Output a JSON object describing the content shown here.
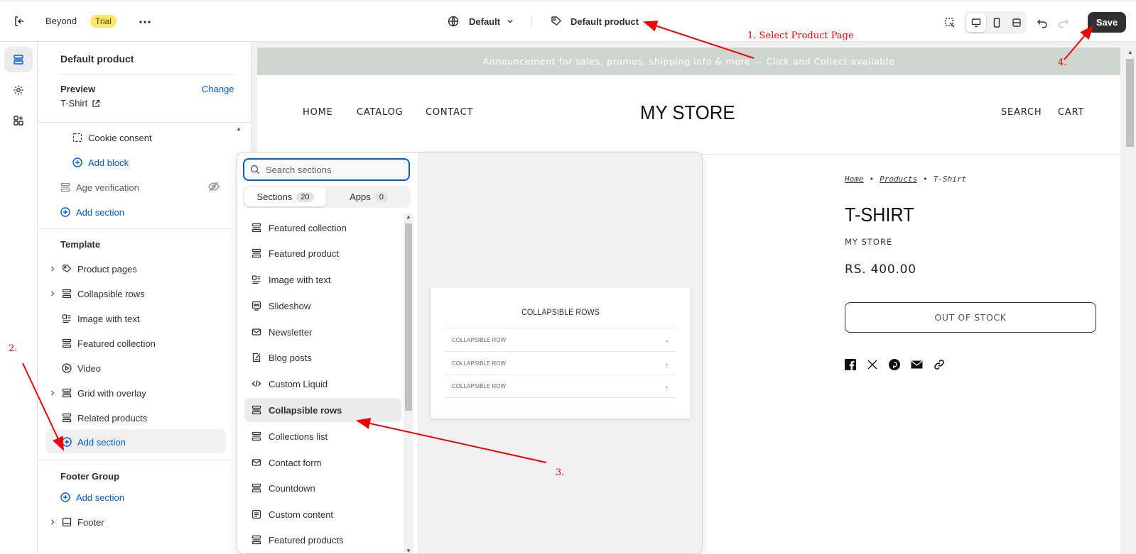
{
  "topbar": {
    "store_name": "Beyond",
    "trial_badge": "Trial",
    "theme_selector": "Default",
    "template_selector": "Default product",
    "save_label": "Save"
  },
  "panel": {
    "title": "Default product",
    "preview_label": "Preview",
    "change_link": "Change",
    "preview_item": "T-Shirt",
    "header_items": [
      {
        "label": "Cookie consent",
        "icon": "block-icon"
      },
      {
        "label": "Add block",
        "icon": "plus-circle-icon"
      },
      {
        "label": "Age verification",
        "icon": "section-icon"
      },
      {
        "label": "Add section",
        "icon": "plus-circle-icon"
      }
    ],
    "template_heading": "Template",
    "template_items": [
      {
        "label": "Product pages",
        "icon": "tag-icon"
      },
      {
        "label": "Collapsible rows",
        "icon": "section-icon"
      },
      {
        "label": "Image with text",
        "icon": "image-text-icon"
      },
      {
        "label": "Featured collection",
        "icon": "section-icon"
      },
      {
        "label": "Video",
        "icon": "play-icon"
      },
      {
        "label": "Grid with overlay",
        "icon": "section-icon"
      },
      {
        "label": "Related products",
        "icon": "section-icon"
      },
      {
        "label": "Add section",
        "icon": "plus-circle-icon"
      }
    ],
    "footer_heading": "Footer Group",
    "footer_add": "Add section",
    "footer_item": "Footer"
  },
  "picker": {
    "search_placeholder": "Search sections",
    "tab_sections": "Sections",
    "tab_sections_count": "20",
    "tab_apps": "Apps",
    "tab_apps_count": "0",
    "items": [
      "Featured collection",
      "Featured product",
      "Image with text",
      "Slideshow",
      "Newsletter",
      "Blog posts",
      "Custom Liquid",
      "Collapsible rows",
      "Collections list",
      "Contact form",
      "Countdown",
      "Custom content",
      "Featured products"
    ],
    "preview_card": {
      "title": "COLLAPSIBLE ROWS",
      "rows": [
        "COLLAPSIBLE ROW",
        "COLLAPSIBLE ROW",
        "COLLAPSIBLE ROW"
      ]
    }
  },
  "store": {
    "announcement": "Announcement for sales, promos, shipping info & more — Click and Collect available",
    "nav_left": [
      "HOME",
      "CATALOG",
      "CONTACT"
    ],
    "logo": "MY STORE",
    "nav_right": [
      "SEARCH",
      "CART"
    ],
    "breadcrumb": [
      "Home",
      "Products",
      "T-Shirt"
    ],
    "product_title": "T-SHIRT",
    "vendor": "MY STORE",
    "price": "RS. 400.00",
    "stock_button": "OUT OF STOCK"
  },
  "annotations": {
    "step1": "1. Select Product Page",
    "step2": "2.",
    "step3": "3.",
    "step4": "4."
  },
  "colors": {
    "accent": "#005bd3",
    "announcement_bg": "#cfd6cf",
    "trial_badge": "#ffe66d",
    "annotation": "#e00000"
  }
}
